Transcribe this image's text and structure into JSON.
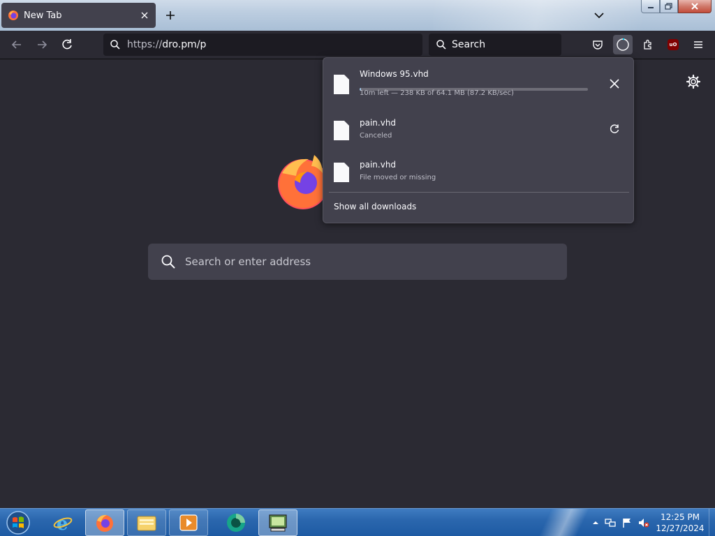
{
  "tabs": [
    {
      "title": "New Tab"
    }
  ],
  "window_controls": {
    "minimize": "minimize",
    "maximize": "maximize",
    "close": "close"
  },
  "navbar": {
    "url_scheme": "https://",
    "url_rest": "dro.pm/p",
    "search_placeholder": "Search"
  },
  "newtab": {
    "search_placeholder": "Search or enter address"
  },
  "downloads": {
    "items": [
      {
        "name": "Windows 95.vhd",
        "status": "10m left — 238 KB of 64.1 MB (87.2 KB/sec)",
        "progress": 0.004,
        "action": "cancel"
      },
      {
        "name": "pain.vhd",
        "status": "Canceled",
        "action": "retry"
      },
      {
        "name": "pain.vhd",
        "status": "File moved or missing"
      }
    ],
    "show_all_label": "Show all downloads"
  },
  "taskbar": {
    "apps": [
      "internet-explorer",
      "firefox",
      "file-explorer",
      "media-player",
      "green-app",
      "control-panel"
    ],
    "clock_time": "12:25 PM",
    "clock_date": "12/27/2024"
  },
  "colors": {
    "chrome_bg": "#2b2a33",
    "tab_bg": "#42414d",
    "field_bg": "#1c1b22",
    "panel_bg": "#42414d",
    "taskbar_blue": "#2b67ae"
  }
}
